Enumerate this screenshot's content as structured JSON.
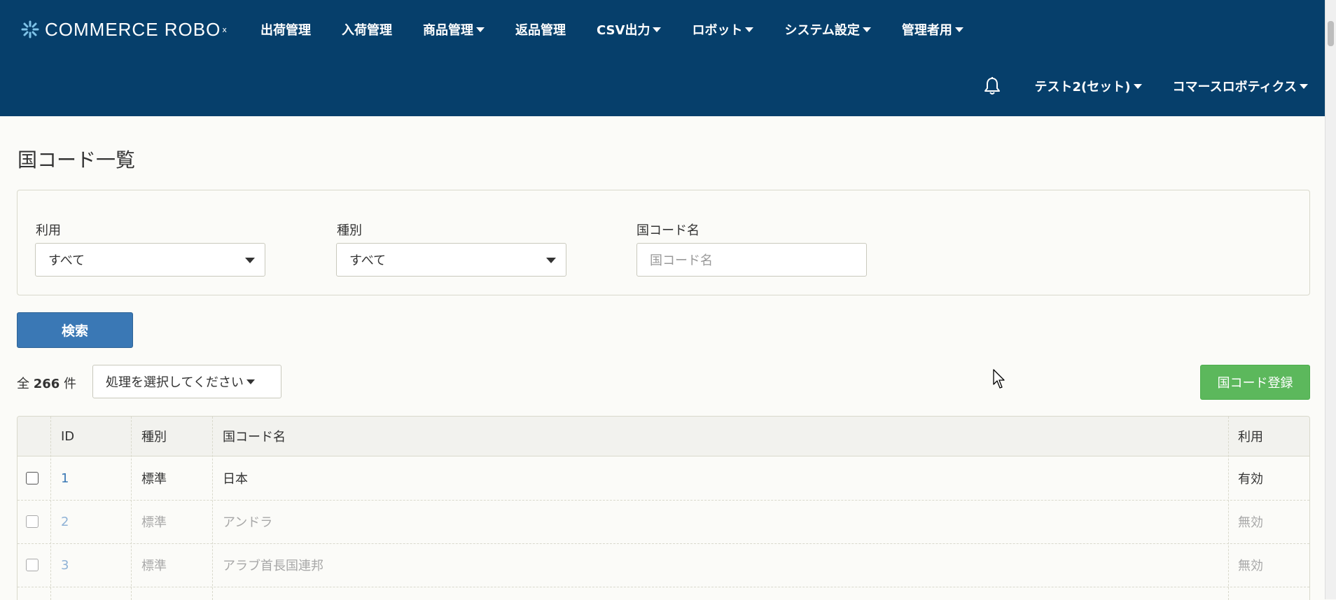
{
  "header": {
    "logo_text": "COMMERCE ROBO",
    "logo_mark": "x",
    "nav": [
      {
        "label": "出荷管理",
        "dropdown": false
      },
      {
        "label": "入荷管理",
        "dropdown": false
      },
      {
        "label": "商品管理",
        "dropdown": true
      },
      {
        "label": "返品管理",
        "dropdown": false
      },
      {
        "label": "CSV出力",
        "dropdown": true
      },
      {
        "label": "ロボット",
        "dropdown": true
      },
      {
        "label": "システム設定",
        "dropdown": true
      },
      {
        "label": "管理者用",
        "dropdown": true
      }
    ],
    "notification_icon": "bell-icon",
    "account": "テスト2(セット)",
    "company": "コマースロボティクス"
  },
  "page": {
    "title": "国コード一覧"
  },
  "filters": {
    "usage_label": "利用",
    "usage_value": "すべて",
    "type_label": "種別",
    "type_value": "すべて",
    "name_label": "国コード名",
    "name_placeholder": "国コード名"
  },
  "search_button": "検索",
  "list": {
    "count_prefix": "全",
    "count": "266",
    "count_suffix": "件",
    "action_select": "処理を選択してください",
    "register_button": "国コード登録"
  },
  "table": {
    "columns": [
      "ID",
      "種別",
      "国コード名",
      "利用"
    ],
    "rows": [
      {
        "id": "1",
        "type": "標準",
        "name": "日本",
        "usage": "有効",
        "enabled": true
      },
      {
        "id": "2",
        "type": "標準",
        "name": "アンドラ",
        "usage": "無効",
        "enabled": false
      },
      {
        "id": "3",
        "type": "標準",
        "name": "アラブ首長国連邦",
        "usage": "無効",
        "enabled": false
      }
    ]
  },
  "colors": {
    "header_bg": "#063f6b",
    "primary": "#3a78b5",
    "success": "#5cb85c"
  }
}
